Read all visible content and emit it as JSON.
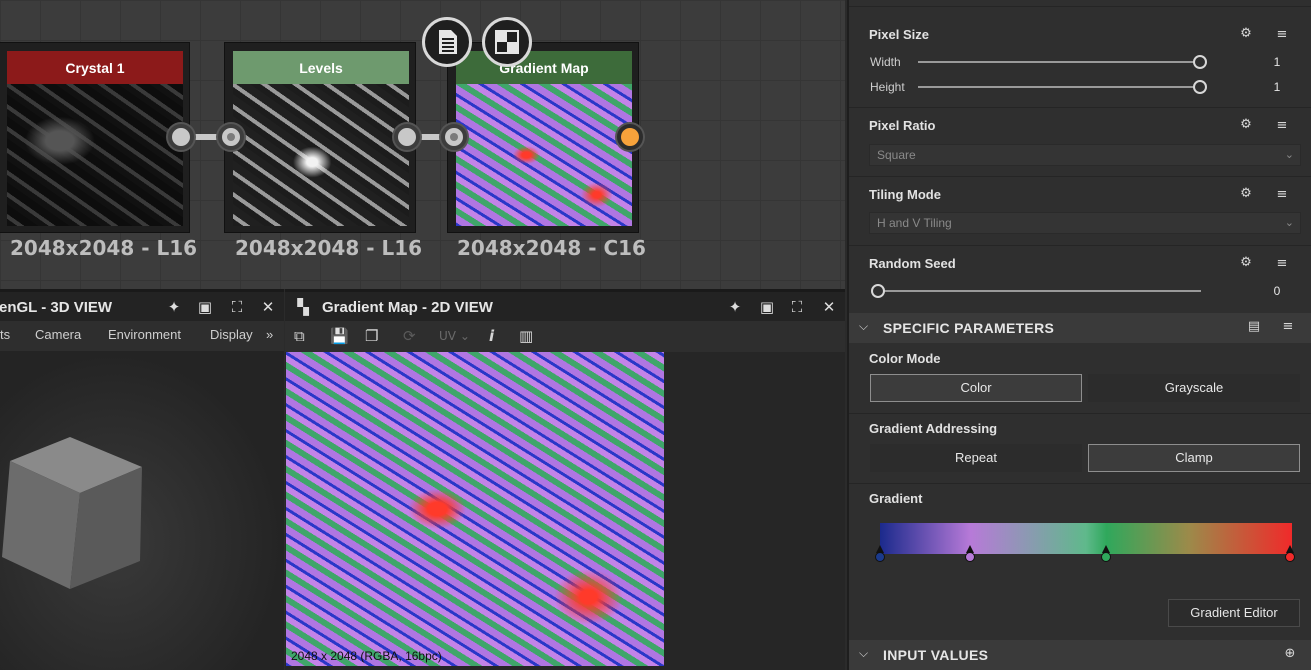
{
  "graph": {
    "nodes": [
      {
        "title": "Crystal 1",
        "resolution": "2048x2048 - L16",
        "header_color": "#8c1a1a"
      },
      {
        "title": "Levels",
        "resolution": "2048x2048 - L16",
        "header_color": "#6e9a6e"
      },
      {
        "title": "Gradient Map",
        "resolution": "2048x2048 - C16",
        "header_color": "#3d6b3a"
      }
    ],
    "buttons": [
      "document-icon",
      "checker-icon"
    ]
  },
  "view3d": {
    "title": "enGL - 3D VIEW",
    "menu": [
      "ts",
      "Camera",
      "Environment",
      "Display"
    ],
    "more": "»"
  },
  "view2d": {
    "title": "Gradient Map - 2D VIEW",
    "uv_label": "UV",
    "status": "2048 x 2048 (RGBA, 16bpc)"
  },
  "props": {
    "pixel_size": {
      "label": "Pixel Size",
      "width_label": "Width",
      "width_value": "1",
      "height_label": "Height",
      "height_value": "1"
    },
    "pixel_ratio": {
      "label": "Pixel Ratio",
      "value": "Square"
    },
    "tiling_mode": {
      "label": "Tiling Mode",
      "value": "H and V Tiling"
    },
    "random_seed": {
      "label": "Random Seed",
      "value": "0"
    },
    "specific": {
      "title": "SPECIFIC PARAMETERS",
      "color_mode": {
        "label": "Color Mode",
        "options": [
          "Color",
          "Grayscale"
        ],
        "selected": "Color"
      },
      "gradient_addressing": {
        "label": "Gradient Addressing",
        "options": [
          "Repeat",
          "Clamp"
        ],
        "selected": "Clamp"
      },
      "gradient": {
        "label": "Gradient",
        "editor_button": "Gradient Editor",
        "stop_colors": [
          "#1b3a8c",
          "#b77ad8",
          "#2fa85c",
          "#f02a2a"
        ]
      }
    },
    "input_values": {
      "title": "INPUT VALUES"
    }
  }
}
